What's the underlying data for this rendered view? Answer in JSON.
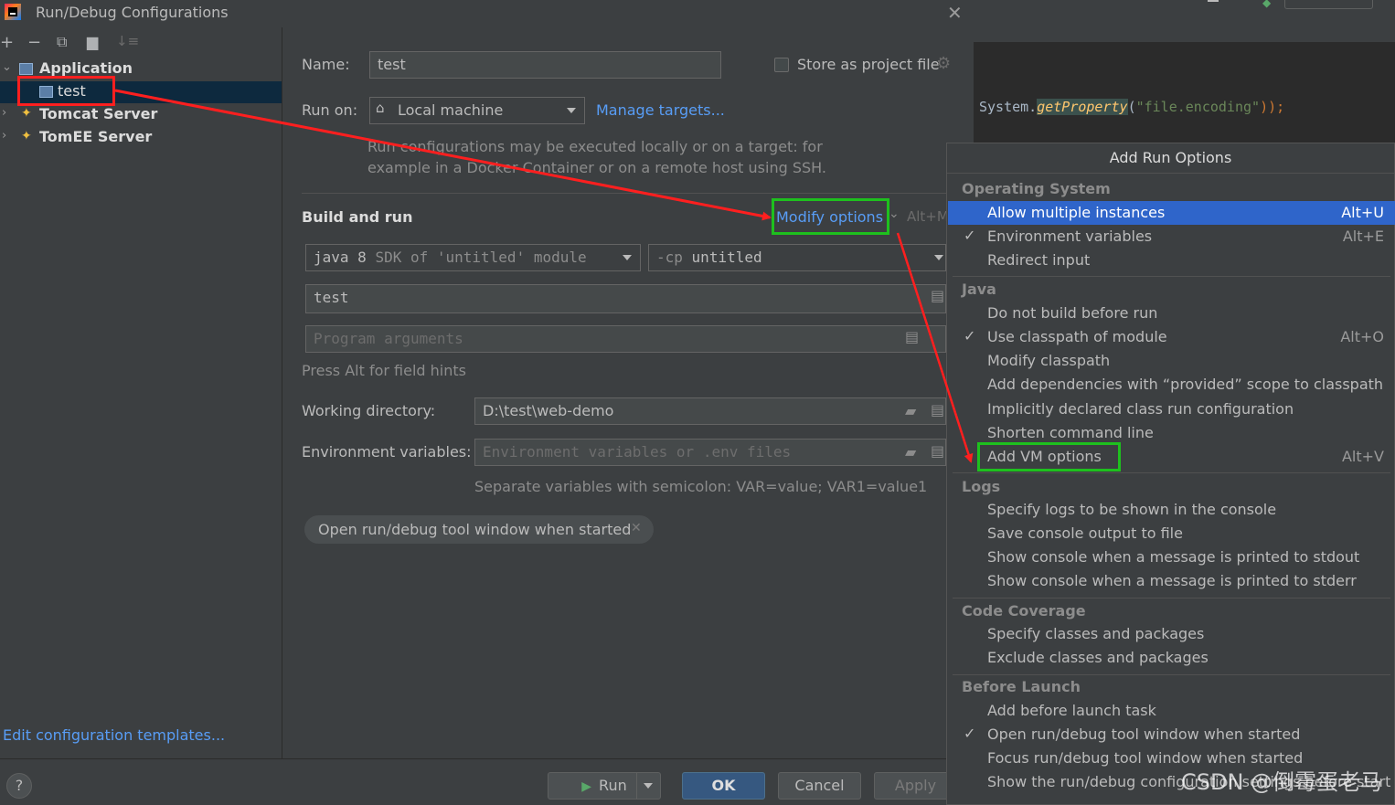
{
  "window": {
    "title": "Run/Debug Configurations",
    "close": "✕"
  },
  "left": {
    "tree": {
      "application": "Application",
      "test": "test",
      "tomcat": "Tomcat Server",
      "tomee": "TomEE Server"
    },
    "edit_templates": "Edit configuration templates..."
  },
  "form": {
    "name_label": "Name:",
    "name_value": "test",
    "store_label": "Store as project file",
    "run_on_label": "Run on:",
    "run_on_value": "Local machine",
    "manage_targets": "Manage targets...",
    "run_on_hint_1": "Run configurations may be executed locally or on a target: for",
    "run_on_hint_2": "example in a Docker Container or on a remote host using SSH.",
    "build_and_run": "Build and run",
    "modify_options": "Modify options",
    "modify_shortcut": "Alt+M",
    "sdk_java": "java 8",
    "sdk_hint": "SDK of 'untitled' module",
    "cp_prefix": "-cp",
    "cp_value": "untitled",
    "main_class": "test",
    "program_args_placeholder": "Program arguments",
    "field_hints": "Press Alt for field hints",
    "working_dir_label": "Working directory:",
    "working_dir_value": "D:\\test\\web-demo",
    "env_label": "Environment variables:",
    "env_placeholder": "Environment variables or .env files",
    "env_hint": "Separate variables with semicolon: VAR=value; VAR1=value1",
    "chip": "Open run/debug tool window when started"
  },
  "buttons": {
    "help": "?",
    "run": "Run",
    "ok": "OK",
    "cancel": "Cancel",
    "apply": "Apply"
  },
  "editor": {
    "code_prefix": "System.",
    "code_method": "getProperty",
    "code_open": "(",
    "code_string": "\"file.encoding\"",
    "code_close": "));"
  },
  "popup": {
    "title": "Add Run Options",
    "sections": {
      "os": "Operating System",
      "java": "Java",
      "logs": "Logs",
      "coverage": "Code Coverage",
      "before": "Before Launch"
    },
    "items": {
      "allow_multiple": {
        "label": "Allow multiple instances",
        "key": "Alt+U"
      },
      "env_vars": {
        "label": "Environment variables",
        "key": "Alt+E"
      },
      "redirect": {
        "label": "Redirect input"
      },
      "no_build": {
        "label": "Do not build before run"
      },
      "use_classpath": {
        "label": "Use classpath of module",
        "key": "Alt+O"
      },
      "modify_classpath": {
        "label": "Modify classpath"
      },
      "add_deps": {
        "label": "Add dependencies with “provided” scope to classpath"
      },
      "implicit": {
        "label": "Implicitly declared class run configuration"
      },
      "shorten": {
        "label": "Shorten command line"
      },
      "vm_options": {
        "label": "Add VM options",
        "key": "Alt+V"
      },
      "logs_console": {
        "label": "Specify logs to be shown in the console"
      },
      "save_console": {
        "label": "Save console output to file"
      },
      "stdout": {
        "label": "Show console when a message is printed to stdout"
      },
      "stderr": {
        "label": "Show console when a message is printed to stderr"
      },
      "specify_classes": {
        "label": "Specify classes and packages"
      },
      "exclude_classes": {
        "label": "Exclude classes and packages"
      },
      "before_task": {
        "label": "Add before launch task"
      },
      "open_tool": {
        "label": "Open run/debug tool window when started"
      },
      "focus_tool": {
        "label": "Focus run/debug tool window when started"
      },
      "show_conf": {
        "label": "Show the run/debug configuration settings before start"
      }
    },
    "check": "✓"
  },
  "watermark": "CSDN @倒霉蛋老马",
  "colors": {
    "accent": "#2f65ca",
    "link": "#589df6",
    "annotation_red": "#ff1f1f",
    "annotation_green": "#1ec01e"
  }
}
